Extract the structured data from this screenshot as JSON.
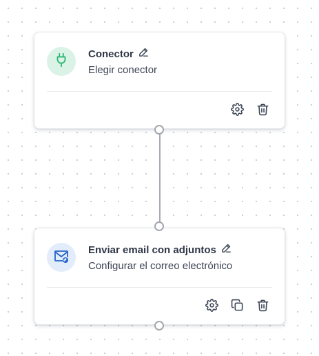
{
  "nodes": [
    {
      "title": "Conector",
      "subtitle": "Elegir conector",
      "icon": "plug-icon",
      "icon_color": "#2bb673",
      "badge_color": "#dbf3e6",
      "actions": [
        "gear-icon",
        "trash-icon"
      ]
    },
    {
      "title": "Enviar email con adjuntos",
      "subtitle": "Configurar el correo electrónico",
      "icon": "email-attachment-icon",
      "icon_color": "#2563c9",
      "badge_color": "#e2ecfa",
      "actions": [
        "gear-icon",
        "copy-icon",
        "trash-icon"
      ]
    }
  ],
  "colors": {
    "text": "#2f3747",
    "edge": "#a7abb3",
    "action_icon": "#3c4454"
  }
}
